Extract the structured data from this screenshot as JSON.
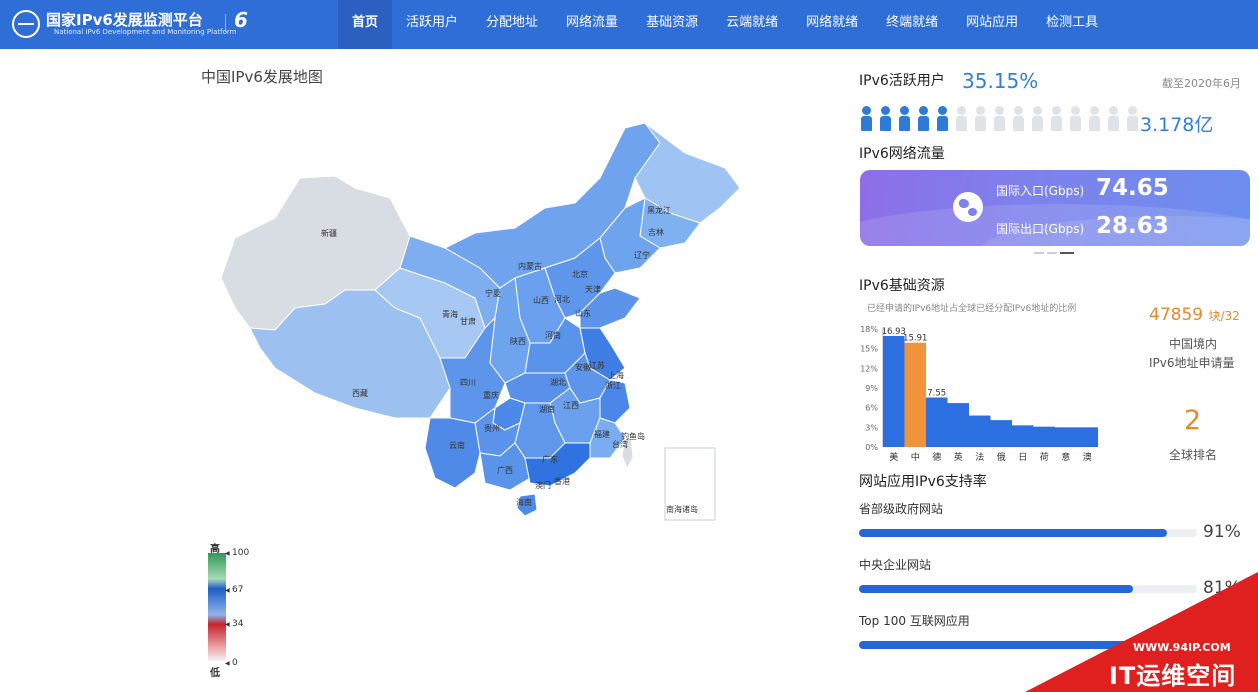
{
  "header": {
    "logo_cn": "国家IPv6发展监测平台",
    "logo_en": "National IPv6 Development and Monitoring Platform",
    "nav": [
      "首页",
      "活跃用户",
      "分配地址",
      "网络流量",
      "基础资源",
      "云端就绪",
      "网络就绪",
      "终端就绪",
      "网站应用",
      "检测工具"
    ],
    "active_nav": "首页"
  },
  "map": {
    "title": "中国IPv6发展地图",
    "provinces": [
      "新疆",
      "西藏",
      "青海",
      "甘肃",
      "宁夏",
      "内蒙古",
      "黑龙江",
      "吉林",
      "辽宁",
      "北京",
      "天津",
      "河北",
      "山西",
      "陕西",
      "山东",
      "河南",
      "江苏",
      "上海",
      "安徽",
      "湖北",
      "四川",
      "重庆",
      "浙江",
      "江西",
      "湖南",
      "贵州",
      "云南",
      "福建",
      "广西",
      "广东",
      "台湾",
      "香港",
      "澳门",
      "海南",
      "钓鱼岛",
      "南海诸岛"
    ],
    "legend": {
      "high": "高",
      "low": "低",
      "ticks": [
        "100",
        "67",
        "34",
        "0"
      ]
    }
  },
  "active_users": {
    "title": "IPv6活跃用户",
    "percent": "35.15%",
    "as_of": "截至2020年6月",
    "count": "3.178亿",
    "icons_on": 5,
    "icons_total": 15
  },
  "traffic": {
    "title": "IPv6网络流量",
    "inbound_label": "国际入口(Gbps)",
    "inbound_value": "74.65",
    "outbound_label": "国际出口(Gbps)",
    "outbound_value": "28.63",
    "colors": {
      "card_start": "#8d6ee8",
      "card_end": "#6c8fee"
    }
  },
  "resources": {
    "title": "IPv6基础资源",
    "subtitle": "已经申请的IPv6地址占全球已经分配IPv6地址的比例",
    "address_count": "47859",
    "address_unit": "块/32",
    "address_label_1": "中国境内",
    "address_label_2": "IPv6地址申请量",
    "rank": "2",
    "rank_label": "全球排名"
  },
  "chart_data": {
    "type": "bar",
    "title": "已经申请的IPv6地址占全球已经分配IPv6地址的比例",
    "categories": [
      "美",
      "中",
      "德",
      "英",
      "法",
      "俄",
      "日",
      "荷",
      "意",
      "澳"
    ],
    "values": [
      16.93,
      15.91,
      7.55,
      6.7,
      4.8,
      4.1,
      3.3,
      3.1,
      3.0,
      3.0
    ],
    "data_labels": [
      "16.93",
      "15.91",
      "7.55"
    ],
    "yticks": [
      "0%",
      "3%",
      "6%",
      "9%",
      "12%",
      "15%",
      "18%"
    ],
    "ylim": [
      0,
      18
    ],
    "highlight_index": 1,
    "colors": {
      "bar": "#2c6fe0",
      "highlight": "#f0933b"
    }
  },
  "websites": {
    "title": "网站应用IPv6支持率",
    "items": [
      {
        "label": "省部级政府网站",
        "percent_text": "91%",
        "value": 0.91
      },
      {
        "label": "中央企业网站",
        "percent_text": "81%",
        "value": 0.81
      },
      {
        "label": "Top 100 互联网应用",
        "percent_text": "",
        "value": 0.9
      }
    ]
  },
  "watermark": {
    "url": "WWW.94IP.COM",
    "brand": "IT运维空间"
  }
}
